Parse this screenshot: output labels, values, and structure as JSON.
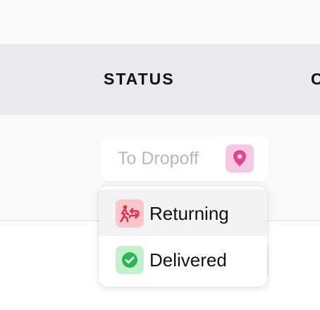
{
  "table": {
    "columns": [
      {
        "label": "STATUS"
      },
      {
        "label": "C"
      }
    ]
  },
  "status_select": {
    "value": "To Dropoff",
    "icon": "map-pin-icon",
    "icon_color": "#e0468f",
    "icon_bg": "#f6c8e2"
  },
  "dropdown": {
    "options": [
      {
        "label": "Returning",
        "icon": "returning-person-icon",
        "icon_color": "#d9344a",
        "icon_bg": "#f8c6cb"
      },
      {
        "label": "Delivered",
        "icon": "check-circle-icon",
        "icon_color": "#2fb556",
        "icon_bg": "#c4f0cd"
      }
    ]
  }
}
